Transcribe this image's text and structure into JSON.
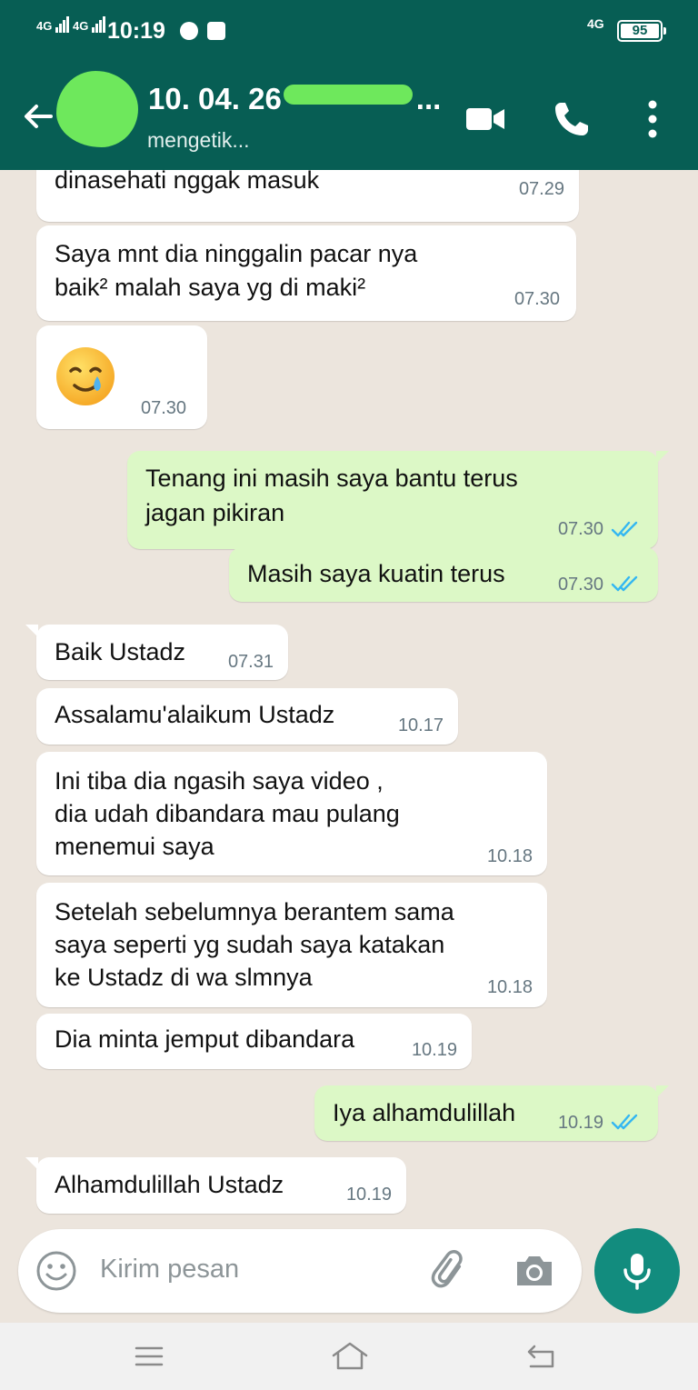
{
  "status_bar": {
    "net1": "4G",
    "net2": "4G",
    "time": "10:19",
    "net_right": "4G",
    "battery": "95"
  },
  "header": {
    "title": "10. 04. 26",
    "title_rest": "...",
    "subtitle": "mengetik...",
    "icons": [
      "back-arrow-icon",
      "video-call-icon",
      "phone-icon",
      "more-vert-icon"
    ]
  },
  "messages": [
    {
      "dir": "in",
      "lines": [
        "dinasehati nggak masuk"
      ],
      "time": "07.29"
    },
    {
      "dir": "in",
      "lines": [
        "Saya mnt dia ninggalin pacar nya",
        "baik² malah saya yg di maki²"
      ],
      "time": "07.30"
    },
    {
      "dir": "in",
      "emoji": "smiling-face-with-tear",
      "time": "07.30"
    },
    {
      "dir": "out",
      "lines": [
        "Tenang ini masih saya bantu terus",
        "jagan pikiran"
      ],
      "time": "07.30",
      "status": "read"
    },
    {
      "dir": "out",
      "lines": [
        "Masih saya kuatin terus"
      ],
      "time": "07.30",
      "status": "read"
    },
    {
      "dir": "in",
      "lines": [
        "Baik Ustadz"
      ],
      "time": "07.31"
    },
    {
      "dir": "in",
      "lines": [
        "Assalamu'alaikum Ustadz"
      ],
      "time": "10.17"
    },
    {
      "dir": "in",
      "lines": [
        "Ini tiba dia ngasih saya video ,",
        "dia udah dibandara mau pulang",
        "menemui saya"
      ],
      "time": "10.18"
    },
    {
      "dir": "in",
      "lines": [
        "Setelah sebelumnya berantem sama",
        "saya seperti yg sudah saya katakan",
        "ke Ustadz di wa slmnya"
      ],
      "time": "10.18"
    },
    {
      "dir": "in",
      "lines": [
        "Dia minta jemput dibandara"
      ],
      "time": "10.19"
    },
    {
      "dir": "out",
      "lines": [
        "Iya alhamdulillah"
      ],
      "time": "10.19",
      "status": "read"
    },
    {
      "dir": "in",
      "lines": [
        "Alhamdulillah Ustadz"
      ],
      "time": "10.19"
    }
  ],
  "input": {
    "placeholder": "Kirim pesan",
    "icons": [
      "emoji-icon",
      "attach-icon",
      "camera-icon",
      "mic-icon"
    ]
  },
  "colors": {
    "header": "#075e54",
    "chat_bg": "#ece5dd",
    "incoming": "#ffffff",
    "outgoing": "#dcf8c6",
    "read_tick": "#34b7f1",
    "mic_button": "#128c7e"
  },
  "nav_bar": {
    "icons": [
      "menu-icon",
      "home-icon",
      "back-icon"
    ]
  }
}
